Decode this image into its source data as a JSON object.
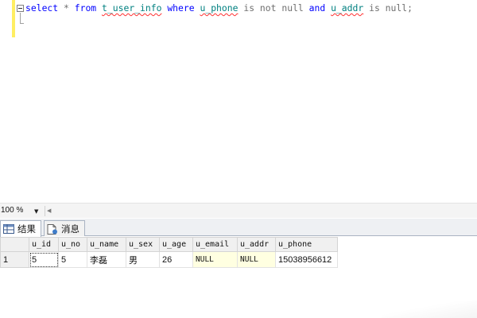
{
  "editor": {
    "query": {
      "kw_select": "select",
      "star": " * ",
      "kw_from": "from",
      "table": "t_user_info",
      "kw_where": "where",
      "col1": "u_phone",
      "cond1": " is not null ",
      "kw_and": "and",
      "col2": "u_addr",
      "cond2": " is null;"
    }
  },
  "zoom": {
    "value": "100 %"
  },
  "tabs": [
    {
      "label": "结果",
      "icon": "grid-icon",
      "active": true
    },
    {
      "label": "消息",
      "icon": "message-icon",
      "active": false
    }
  ],
  "grid": {
    "columns": [
      "u_id",
      "u_no",
      "u_name",
      "u_sex",
      "u_age",
      "u_email",
      "u_addr",
      "u_phone"
    ],
    "rows": [
      {
        "rownum": "1",
        "cells": [
          "5",
          "5",
          "李磊",
          "男",
          "26",
          "NULL",
          "NULL",
          "15038956612"
        ]
      }
    ]
  },
  "colors": {
    "keyword": "#0000ff",
    "identifier": "#008080",
    "null_cell_bg": "#ffffe1",
    "modified_bar": "#ffee62"
  }
}
